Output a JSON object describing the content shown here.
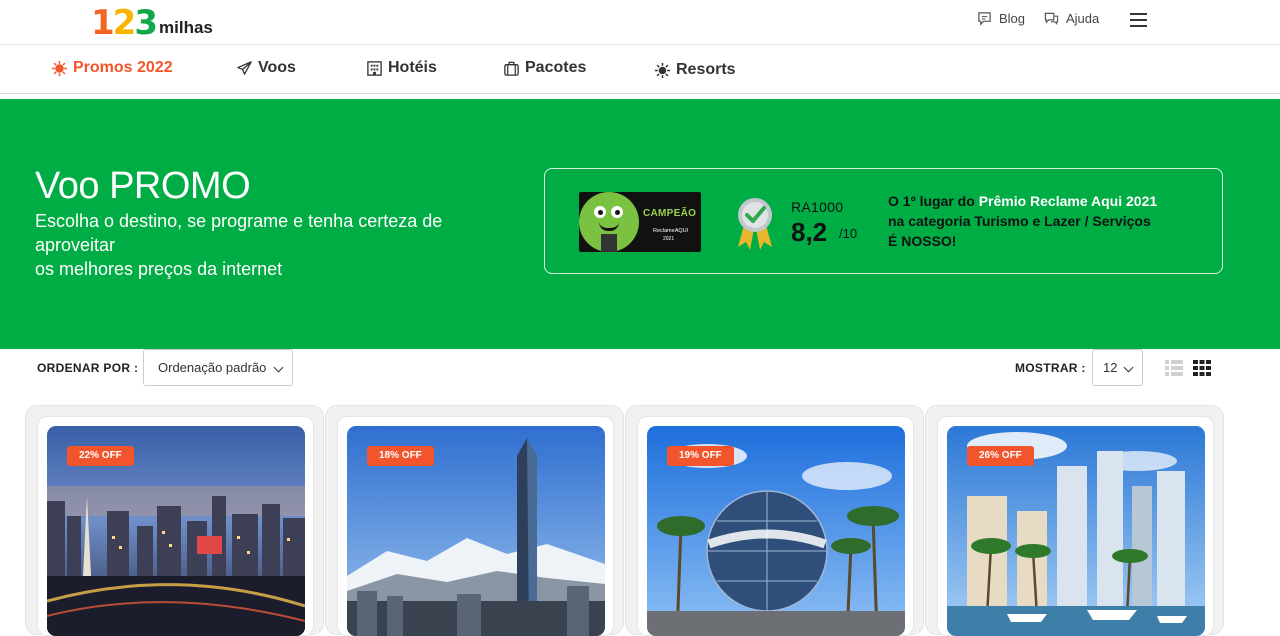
{
  "header": {
    "logo": {
      "digits": [
        "1",
        "2",
        "3"
      ],
      "word": "milhas"
    },
    "links": [
      {
        "label": "Blog",
        "icon": "chat-bubble-icon"
      },
      {
        "label": "Ajuda",
        "icon": "help-chat-icon"
      }
    ],
    "menu_icon": "hamburger-icon"
  },
  "nav": {
    "items": [
      {
        "label": "Promos 2022",
        "icon": "sun-badge-icon",
        "active": true
      },
      {
        "label": "Voos",
        "icon": "airplane-icon",
        "active": false
      },
      {
        "label": "Hotéis",
        "icon": "building-icon",
        "active": false
      },
      {
        "label": "Pacotes",
        "icon": "suitcase-icon",
        "active": false
      },
      {
        "label": "Resorts",
        "icon": "sun-icon",
        "active": false
      }
    ]
  },
  "hero": {
    "title": "Voo PROMO",
    "subtitle_lines": [
      "Escolha o destino, se programe e tenha certeza de",
      "aproveitar",
      "os melhores preços da internet"
    ],
    "badge": {
      "seal_title": "CAMPEÃO",
      "seal_brand": "ReclameAQUI",
      "seal_year": "2021",
      "ra_label": "RA1000",
      "ra_score": "8,2",
      "ra_scale": "/10",
      "text_prefix": "O 1º lugar do ",
      "text_highlight": "Prêmio Reclame Aqui 2021",
      "text_line2": "na categoria Turismo e Lazer / Serviços",
      "text_line3": "É NOSSO!"
    },
    "color": "#00ad45"
  },
  "filters": {
    "sort_label": "ORDENAR POR :",
    "sort_value": "Ordenação padrão",
    "show_label": "MOSTRAR :",
    "show_value": "12",
    "view_icons": [
      "list-view-icon",
      "grid-view-icon"
    ]
  },
  "cards": [
    {
      "discount": "22% OFF",
      "image": "buenos-aires-city-night"
    },
    {
      "discount": "18% OFF",
      "image": "santiago-skyscraper-andes"
    },
    {
      "discount": "19% OFF",
      "image": "universal-globe-palms"
    },
    {
      "discount": "26% OFF",
      "image": "miami-marina-towers"
    }
  ],
  "colors": {
    "accent": "#f2552c",
    "brand_green": "#00ad45"
  }
}
